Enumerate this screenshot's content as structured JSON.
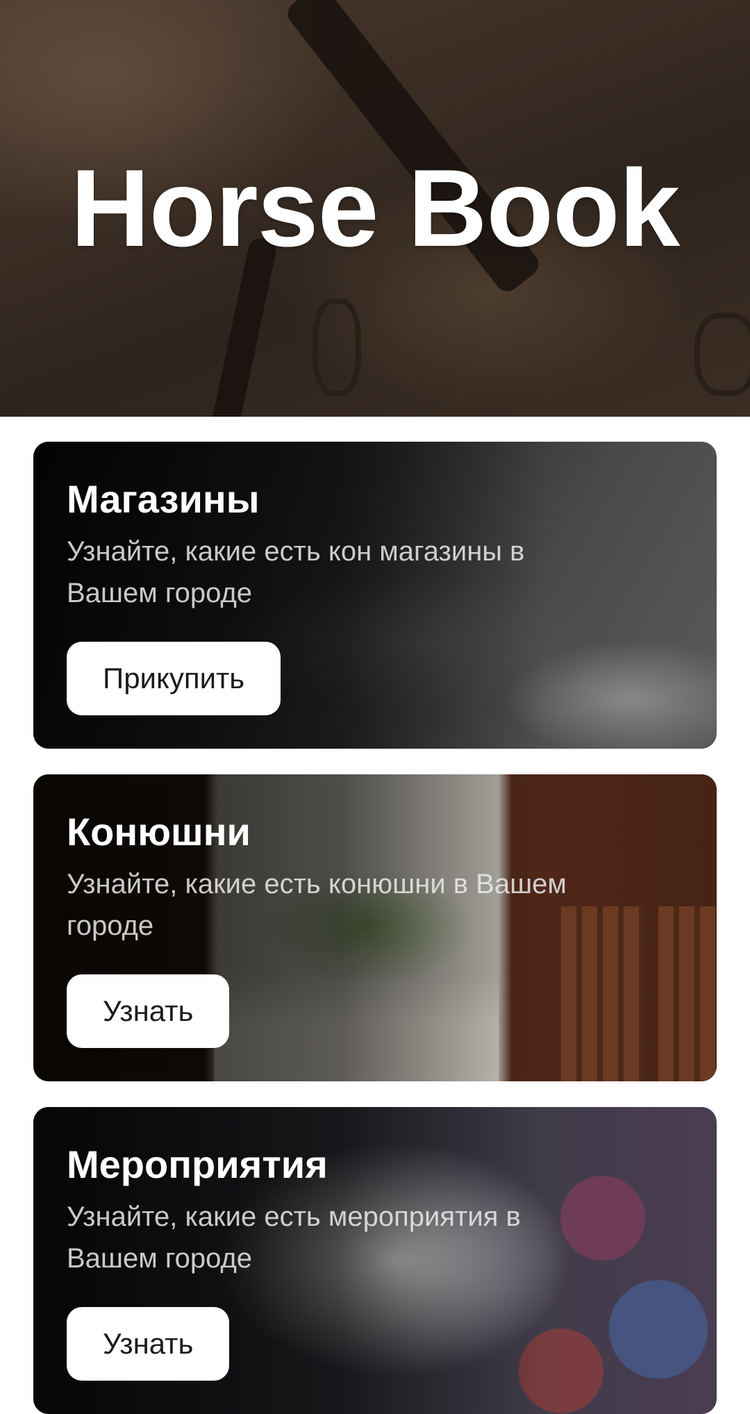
{
  "header": {
    "title": "Horse Book"
  },
  "cards": [
    {
      "title": "Магазины",
      "description": "Узнайте, какие есть кон магазины в Вашем городе",
      "button_label": "Прикупить",
      "image_icon": "saddle-image"
    },
    {
      "title": "Конюшни",
      "description": "Узнайте, какие есть конюшни в Вашем городе",
      "button_label": "Узнать",
      "image_icon": "stable-image"
    },
    {
      "title": "Мероприятия",
      "description": "Узнайте, какие есть мероприятия в Вашем городе",
      "button_label": "Узнать",
      "image_icon": "horse-event-image"
    }
  ],
  "colors": {
    "background": "#ffffff",
    "button_background": "#ffffff",
    "button_text": "#1c1c1c",
    "title_text": "#ffffff"
  }
}
